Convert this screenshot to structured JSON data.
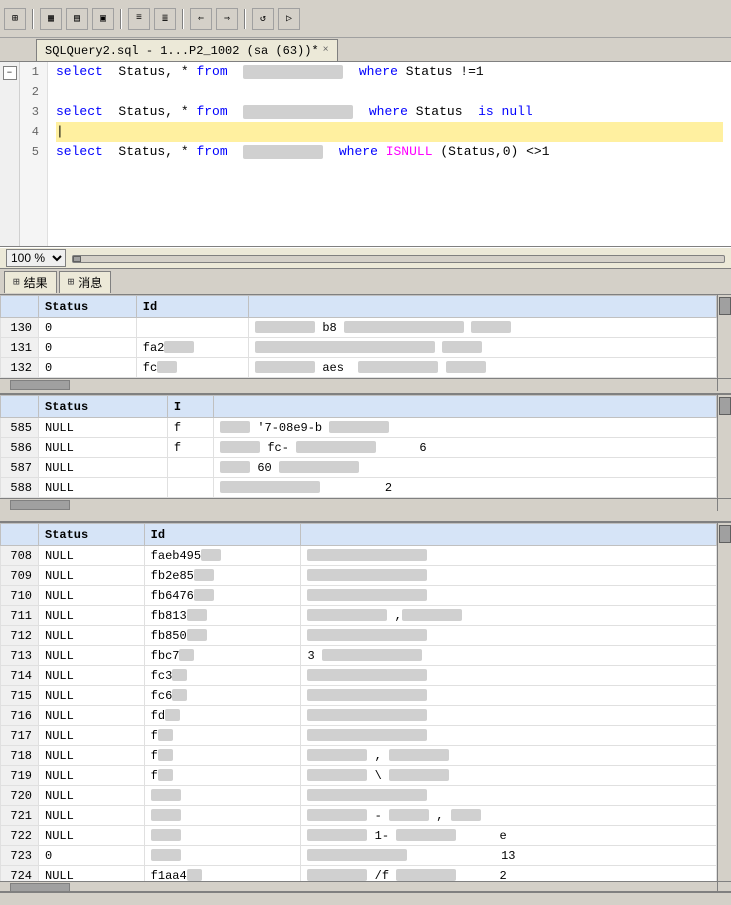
{
  "toolbar": {
    "buttons": [
      "⊞",
      "⊟",
      "□",
      "▦",
      "▤",
      "▣",
      "≡",
      "≣",
      "⇐",
      "⇒",
      "↺"
    ]
  },
  "tab": {
    "title": "SQLQuery2.sql - 1...P2_1002 (sa (63))*",
    "close": "×"
  },
  "editor": {
    "lines": [
      {
        "num": "1",
        "code_html": "<span class='kw'>select</span>  Status, * <span class='kw'>from</span>  <span class='blurred' style='width:110px'>&nbsp;</span>  <span class='kw'>where</span> Status !=1",
        "collapse": "□"
      },
      {
        "num": "2",
        "code_html": ""
      },
      {
        "num": "3",
        "code_html": "<span class='kw'>select</span>  Status, * <span class='kw'>from</span>  <span class='blurred' style='width:110px'>&nbsp;</span>  <span class='kw'>where</span> Status  <span class='kw'>is null</span>"
      },
      {
        "num": "4",
        "code_html": "|",
        "cursor": true
      },
      {
        "num": "5",
        "code_html": "<span class='kw'>select</span>  Status, * <span class='kw'>from</span>  <span class='blurred' style='width:80px'>&nbsp;</span>  <span class='kw'>where</span> <span style='color:#ff00ff'>ISNULL</span> (Status,0) &lt;&gt;1"
      }
    ],
    "zoom": "100 %"
  },
  "results_tabs": [
    {
      "icon": "⊞",
      "label": "结果"
    },
    {
      "icon": "⊞",
      "label": "消息"
    }
  ],
  "result1": {
    "columns": [
      "",
      "Status",
      "Id"
    ],
    "rows": [
      {
        "rownum": "130",
        "status": "0",
        "id": "",
        "extra": "b8"
      },
      {
        "rownum": "131",
        "status": "0",
        "id": "fa2",
        "extra": ""
      },
      {
        "rownum": "132",
        "status": "0",
        "id": "fc",
        "extra": "aes"
      }
    ]
  },
  "result2": {
    "columns": [
      "",
      "Status",
      "I"
    ],
    "rows": [
      {
        "rownum": "585",
        "status": "NULL",
        "id": "f",
        "extra": "'7-08e9-b"
      },
      {
        "rownum": "586",
        "status": "NULL",
        "id": "f",
        "extra": "fc-"
      },
      {
        "rownum": "587",
        "status": "NULL",
        "id": "",
        "extra": "60"
      },
      {
        "rownum": "588",
        "status": "NULL",
        "id": "",
        "extra": ""
      }
    ]
  },
  "result3": {
    "columns": [
      "",
      "Status",
      "Id"
    ],
    "rows": [
      {
        "rownum": "708",
        "status": "NULL",
        "id": "faeb495"
      },
      {
        "rownum": "709",
        "status": "NULL",
        "id": "fb2e85"
      },
      {
        "rownum": "710",
        "status": "NULL",
        "id": "fb6476"
      },
      {
        "rownum": "711",
        "status": "NULL",
        "id": "fb813"
      },
      {
        "rownum": "712",
        "status": "NULL",
        "id": "fb850"
      },
      {
        "rownum": "713",
        "status": "NULL",
        "id": "fbc7"
      },
      {
        "rownum": "714",
        "status": "NULL",
        "id": "fc3"
      },
      {
        "rownum": "715",
        "status": "NULL",
        "id": "fc6"
      },
      {
        "rownum": "716",
        "status": "NULL",
        "id": "fd"
      },
      {
        "rownum": "717",
        "status": "NULL",
        "id": "f"
      },
      {
        "rownum": "718",
        "status": "NULL",
        "id": "f"
      },
      {
        "rownum": "719",
        "status": "NULL",
        "id": "f"
      },
      {
        "rownum": "720",
        "status": "NULL",
        "id": ""
      },
      {
        "rownum": "721",
        "status": "NULL",
        "id": ""
      },
      {
        "rownum": "722",
        "status": "NULL",
        "id": ""
      },
      {
        "rownum": "723",
        "status": "0",
        "id": ""
      },
      {
        "rownum": "724",
        "status": "NULL",
        "id": "f1aa4"
      }
    ]
  }
}
